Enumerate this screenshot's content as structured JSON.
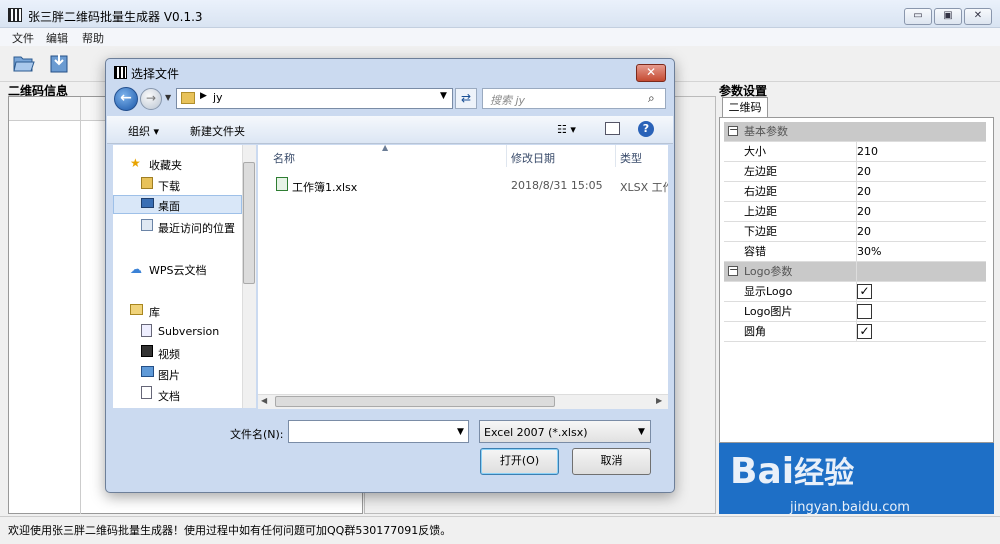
{
  "window": {
    "title": "张三胖二维码批量生成器 V0.1.3",
    "min": "▭",
    "max": "▣",
    "close": "✕"
  },
  "menu": [
    "文件",
    "编辑",
    "帮助"
  ],
  "left_panel": {
    "title": "二维码信息"
  },
  "right_panel": {
    "title": "参数设置",
    "tab": "二维码",
    "categories": [
      {
        "label": "基本参数",
        "rows": [
          {
            "name": "大小",
            "value": "210"
          },
          {
            "name": "左边距",
            "value": "20"
          },
          {
            "name": "右边距",
            "value": "20"
          },
          {
            "name": "上边距",
            "value": "20"
          },
          {
            "name": "下边距",
            "value": "20"
          },
          {
            "name": "容错",
            "value": "30%"
          }
        ]
      },
      {
        "label": "Logo参数",
        "rows": [
          {
            "name": "显示Logo",
            "checked": true
          },
          {
            "name": "Logo图片",
            "checked": false
          },
          {
            "name": "圆角",
            "checked": true
          }
        ]
      }
    ]
  },
  "status": {
    "text": "欢迎使用张三胖二维码批量生成器！使用过程中如有任何问题可加QQ群530177091反馈。"
  },
  "watermark": {
    "logo": "Bai经验",
    "url": "jingyan.baidu.com"
  },
  "dialog": {
    "title": "选择文件",
    "address": "jy",
    "search_placeholder": "搜索 jy",
    "organize": "组织 ▾",
    "new_folder": "新建文件夹",
    "nav": {
      "favorites": "收藏夹",
      "downloads": "下载",
      "desktop": "桌面",
      "recent": "最近访问的位置",
      "wps": "WPS云文档",
      "library": "库",
      "subversion": "Subversion",
      "video": "视频",
      "pictures": "图片",
      "documents": "文档"
    },
    "columns": {
      "name": "名称",
      "date": "修改日期",
      "type": "类型"
    },
    "files": [
      {
        "name": "工作簿1.xlsx",
        "date": "2018/8/31 15:05",
        "type": "XLSX 工作"
      }
    ],
    "filename_label": "文件名(N):",
    "filename_value": "",
    "filetype": "Excel 2007 (*.xlsx)",
    "open_label": "打开(O)",
    "cancel_label": "取消"
  }
}
